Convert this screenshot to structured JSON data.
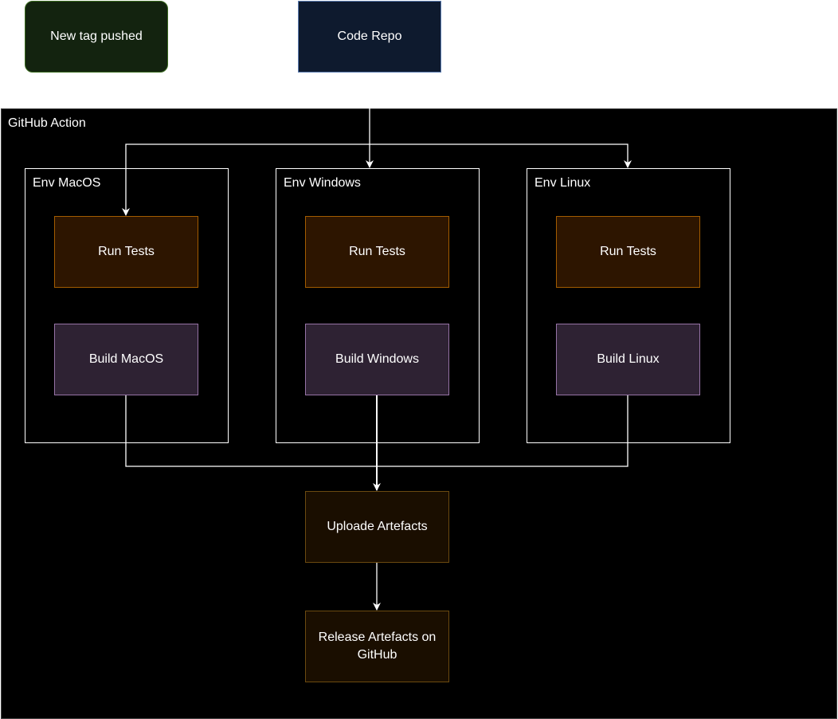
{
  "trigger": {
    "label": "New tag pushed",
    "fill": "#13230f",
    "stroke": "#3a6b1f"
  },
  "repo": {
    "label": "Code Repo",
    "fill": "#0e1a2e",
    "stroke": "#5a7bb0"
  },
  "action": {
    "label": "GitHub Action"
  },
  "envs": [
    {
      "label": "Env MacOS",
      "test": "Run Tests",
      "build": "Build MacOS"
    },
    {
      "label": "Env Windows",
      "test": "Run Tests",
      "build": "Build Windows"
    },
    {
      "label": "Env Linux",
      "test": "Run Tests",
      "build": "Build Linux"
    }
  ],
  "upload": {
    "label": "Uploade Artefacts"
  },
  "release": {
    "label": "Release Artefacts on GitHub"
  },
  "colors": {
    "test_fill": "#2d1500",
    "test_stroke": "#a35c00",
    "build_fill": "#2e2233",
    "build_stroke": "#9673a6",
    "artefact_fill": "#1a0e00",
    "artefact_stroke": "#6b4a10"
  }
}
